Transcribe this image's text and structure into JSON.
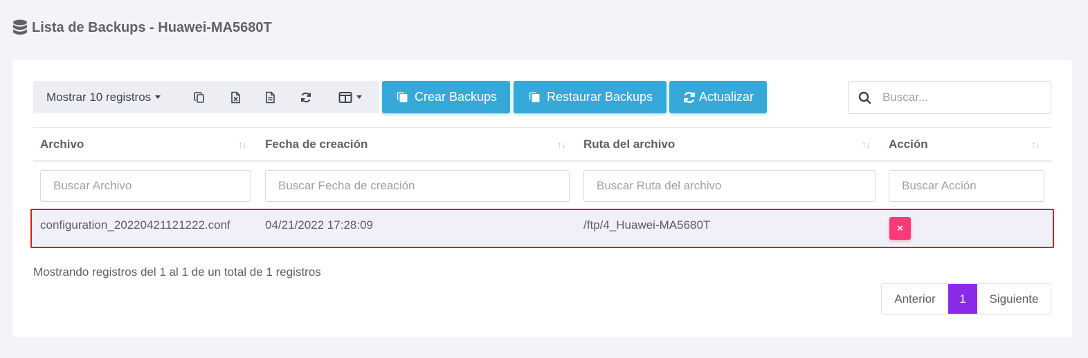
{
  "header": {
    "title": "Lista de Backups - Huawei-MA5680T"
  },
  "toolbar": {
    "show_label": "Mostrar 10 registros",
    "create_label": "Crear Backups",
    "restore_label": "Restaurar Backups",
    "refresh_label": "Actualizar"
  },
  "search": {
    "placeholder": "Buscar..."
  },
  "table": {
    "columns": [
      "Archivo",
      "Fecha de creación",
      "Ruta del archivo",
      "Acción"
    ],
    "filters": [
      "Buscar Archivo",
      "Buscar Fecha de creación",
      "Buscar Ruta del archivo",
      "Buscar Acción"
    ],
    "rows": [
      {
        "archivo": "configuration_20220421121222.conf",
        "fecha": "04/21/2022 17:28:09",
        "ruta": "/ftp/4_Huawei-MA5680T",
        "accion": "×"
      }
    ]
  },
  "footer": {
    "info": "Mostrando registros del 1 al 1 de un total de 1 registros",
    "prev": "Anterior",
    "page": "1",
    "next": "Siguiente"
  },
  "colors": {
    "accent_blue": "#36a9d9",
    "danger_pink": "#fd3a78",
    "page_active": "#8a2be8",
    "highlight_border": "#e01a1a"
  },
  "icons": [
    "database-icon",
    "copy-icon",
    "excel-icon",
    "csv-icon",
    "sync-icon",
    "columns-icon",
    "search-icon"
  ]
}
